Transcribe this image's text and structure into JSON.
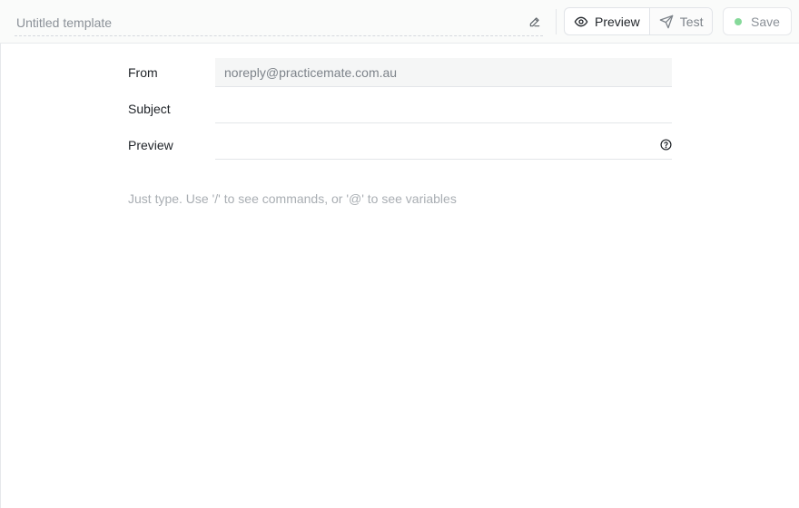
{
  "header": {
    "template_title": "Untitled template",
    "preview_label": "Preview",
    "test_label": "Test",
    "save_label": "Save",
    "save_status_color": "#86d99a"
  },
  "form": {
    "from_label": "From",
    "from_value": "noreply@practicemate.com.au",
    "subject_label": "Subject",
    "subject_value": "",
    "preview_label": "Preview",
    "preview_value": ""
  },
  "editor": {
    "placeholder": "Just type. Use '/' to see commands, or '@' to see variables"
  },
  "icons": {
    "title_edit": "pencil-icon",
    "preview": "eye-icon",
    "test": "send-icon",
    "save_status": "status-dot",
    "preview_help": "help-circle-icon"
  }
}
